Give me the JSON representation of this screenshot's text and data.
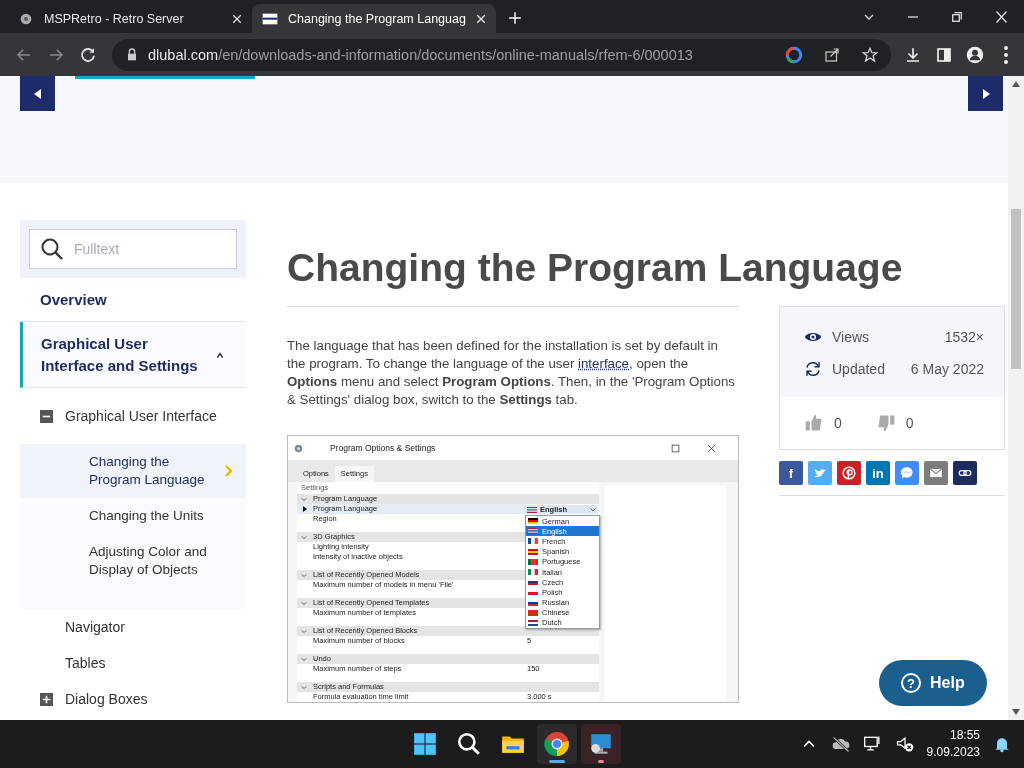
{
  "browser": {
    "tabs": [
      {
        "title": "MSPRetro - Retro Server",
        "selected": false
      },
      {
        "title": "Changing the Program Languag",
        "selected": true
      }
    ],
    "url_host": "dlubal.com",
    "url_path": "/en/downloads-and-information/documents/online-manuals/rfem-6/000013"
  },
  "sidebar": {
    "search_placeholder": "Fulltext",
    "items": [
      {
        "label": "Overview",
        "selected": false
      },
      {
        "label": "Graphical User Interface and Settings",
        "selected": false,
        "expanded": true,
        "children": [
          {
            "label": "Graphical User Interface",
            "selected": false,
            "expanded": true,
            "children": [
              {
                "label": "Changing the Program Language",
                "selected": true
              },
              {
                "label": "Changing the Units",
                "selected": false
              },
              {
                "label": "Adjusting Color and Display of Objects",
                "selected": false
              }
            ]
          },
          {
            "label": "Navigator",
            "selected": false
          },
          {
            "label": "Tables",
            "selected": false
          },
          {
            "label": "Dialog Boxes",
            "selected": false,
            "expanded": false
          }
        ]
      }
    ]
  },
  "article": {
    "title": "Changing the Program Language",
    "paragraph": {
      "before": "The language that has been defined for the installation is set by default in the program. To change the language of the user ",
      "link": "interface",
      "after": ", open the **Options** menu and select **Program Options**. Then, in the 'Program Options & Settings' dialog box, switch to the **Settings** tab."
    },
    "screenshot": {
      "title": "Program Options & Settings",
      "tabs": [
        {
          "label": "Options",
          "selected": false
        },
        {
          "label": "Settings",
          "selected": true
        }
      ],
      "panel_title": "Settings",
      "groups": [
        {
          "title": "Program Language",
          "expanded": true,
          "rows": [
            {
              "label": "Program Language",
              "selected": true
            },
            {
              "label": "Region",
              "selected": false
            }
          ]
        },
        {
          "title": "3D Graphics",
          "expanded": true,
          "rows": [
            {
              "label": "Lighting intensity",
              "selected": false
            },
            {
              "label": "Intensity of inactive objects",
              "selected": false
            }
          ]
        },
        {
          "title": "List of Recently Opened Models",
          "expanded": true,
          "rows": [
            {
              "label": "Maximum number of models in menu 'File'",
              "selected": false
            }
          ]
        },
        {
          "title": "List of Recently Opened Templates",
          "expanded": true,
          "rows": [
            {
              "label": "Maximum number of templates",
              "selected": false
            }
          ]
        },
        {
          "title": "List of Recently Opened Blocks",
          "expanded": true,
          "rows": [
            {
              "label": "Maximum number of blocks",
              "selected": false,
              "value": "5"
            }
          ]
        },
        {
          "title": "Undo",
          "expanded": true,
          "rows": [
            {
              "label": "Maximum number of steps",
              "selected": false,
              "value": "150"
            }
          ]
        },
        {
          "title": "Scripts and Formulas",
          "expanded": true,
          "rows": [
            {
              "label": "Formula evaluation time limit",
              "selected": false,
              "value": "3.000 s"
            }
          ]
        }
      ],
      "dropdown": {
        "value": "English",
        "options": [
          {
            "label": "German",
            "selected": false
          },
          {
            "label": "English",
            "selected": true
          },
          {
            "label": "French",
            "selected": false
          },
          {
            "label": "Spanish",
            "selected": false
          },
          {
            "label": "Portuguese",
            "selected": false
          },
          {
            "label": "Italian",
            "selected": false
          },
          {
            "label": "Czech",
            "selected": false
          },
          {
            "label": "Polish",
            "selected": false
          },
          {
            "label": "Russian",
            "selected": false
          },
          {
            "label": "Chinese",
            "selected": false
          },
          {
            "label": "Dutch",
            "selected": false
          }
        ]
      }
    }
  },
  "info": {
    "views_label": "Views",
    "views": "1532×",
    "updated_label": "Updated",
    "updated": "6 May 2022",
    "likes": "0",
    "dislikes": "0"
  },
  "share": [
    {
      "kind": "glyph",
      "glyph": "f",
      "color": "#3b5998"
    },
    {
      "kind": "bird",
      "color": "#55acee"
    },
    {
      "kind": "pin",
      "color": "#cb2027"
    },
    {
      "kind": "glyph",
      "glyph": "in",
      "color": "#0077b5"
    },
    {
      "kind": "chat",
      "color": "#448aff"
    },
    {
      "kind": "mail",
      "color": "#7d7d7d"
    },
    {
      "kind": "link",
      "color": "#1d2b5e"
    }
  ],
  "help": {
    "icon": "?",
    "label": "Help"
  },
  "taskbar": {
    "apps": [
      {
        "kind": "start"
      },
      {
        "kind": "search"
      },
      {
        "kind": "folder"
      },
      {
        "kind": "chrome",
        "running": true,
        "selected": true
      },
      {
        "kind": "remote",
        "running": true,
        "selected": false
      }
    ],
    "time": "18:55",
    "date": "9.09.2023"
  }
}
